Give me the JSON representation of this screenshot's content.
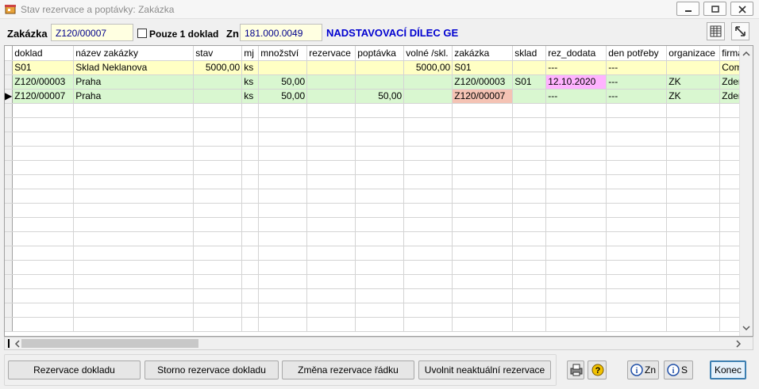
{
  "window": {
    "title": "Stav rezervace a poptávky: Zakázka"
  },
  "header": {
    "zakazka_label": "Zakázka",
    "zakazka_value": "Z120/00007",
    "pouze_label": "Pouze 1 doklad",
    "zn_label": "Zn",
    "zn_value": "181.000.0049",
    "zn_desc": "NADSTAVOVACÍ DÍLEC GE"
  },
  "columns": [
    "doklad",
    "název zakázky",
    "stav",
    "mj",
    "množství",
    "rezervace",
    "poptávka",
    "volné /skl.",
    "zakázka",
    "sklad",
    "rez_dodata",
    "den potřeby",
    "organizace",
    "firma"
  ],
  "rows": [
    {
      "doklad": "S01",
      "nazev": "Sklad Neklanova",
      "stav": "5000,00",
      "mj": "ks",
      "mnozstvi": "",
      "rezervace": "",
      "poptavka": "",
      "volne": "5000,00",
      "zakazka": "S01",
      "sklad": "",
      "rez_dodata": "---",
      "den": "---",
      "org": "",
      "firma": "Com"
    },
    {
      "doklad": "Z120/00003",
      "nazev": "Praha",
      "stav": "",
      "mj": "ks",
      "mnozstvi": "50,00",
      "rezervace": "",
      "poptavka": "",
      "volne": "",
      "zakazka": "Z120/00003",
      "sklad": "S01",
      "rez_dodata": "12.10.2020",
      "den": "---",
      "org": "ZK",
      "firma": "Zden"
    },
    {
      "doklad": "Z120/00007",
      "nazev": "Praha",
      "stav": "",
      "mj": "ks",
      "mnozstvi": "50,00",
      "rezervace": "",
      "poptavka": "50,00",
      "volne": "",
      "zakazka": "Z120/00007",
      "sklad": "",
      "rez_dodata": "---",
      "den": "---",
      "org": "ZK",
      "firma": "Zden"
    }
  ],
  "buttons": {
    "rezervace": "Rezervace dokladu",
    "storno": "Storno rezervace dokladu",
    "zmena": "Změna rezervace řádku",
    "uvolnit": "Uvolnit neaktuální rezervace",
    "info_zn": "Zn",
    "info_s": "S",
    "konec": "Konec"
  }
}
